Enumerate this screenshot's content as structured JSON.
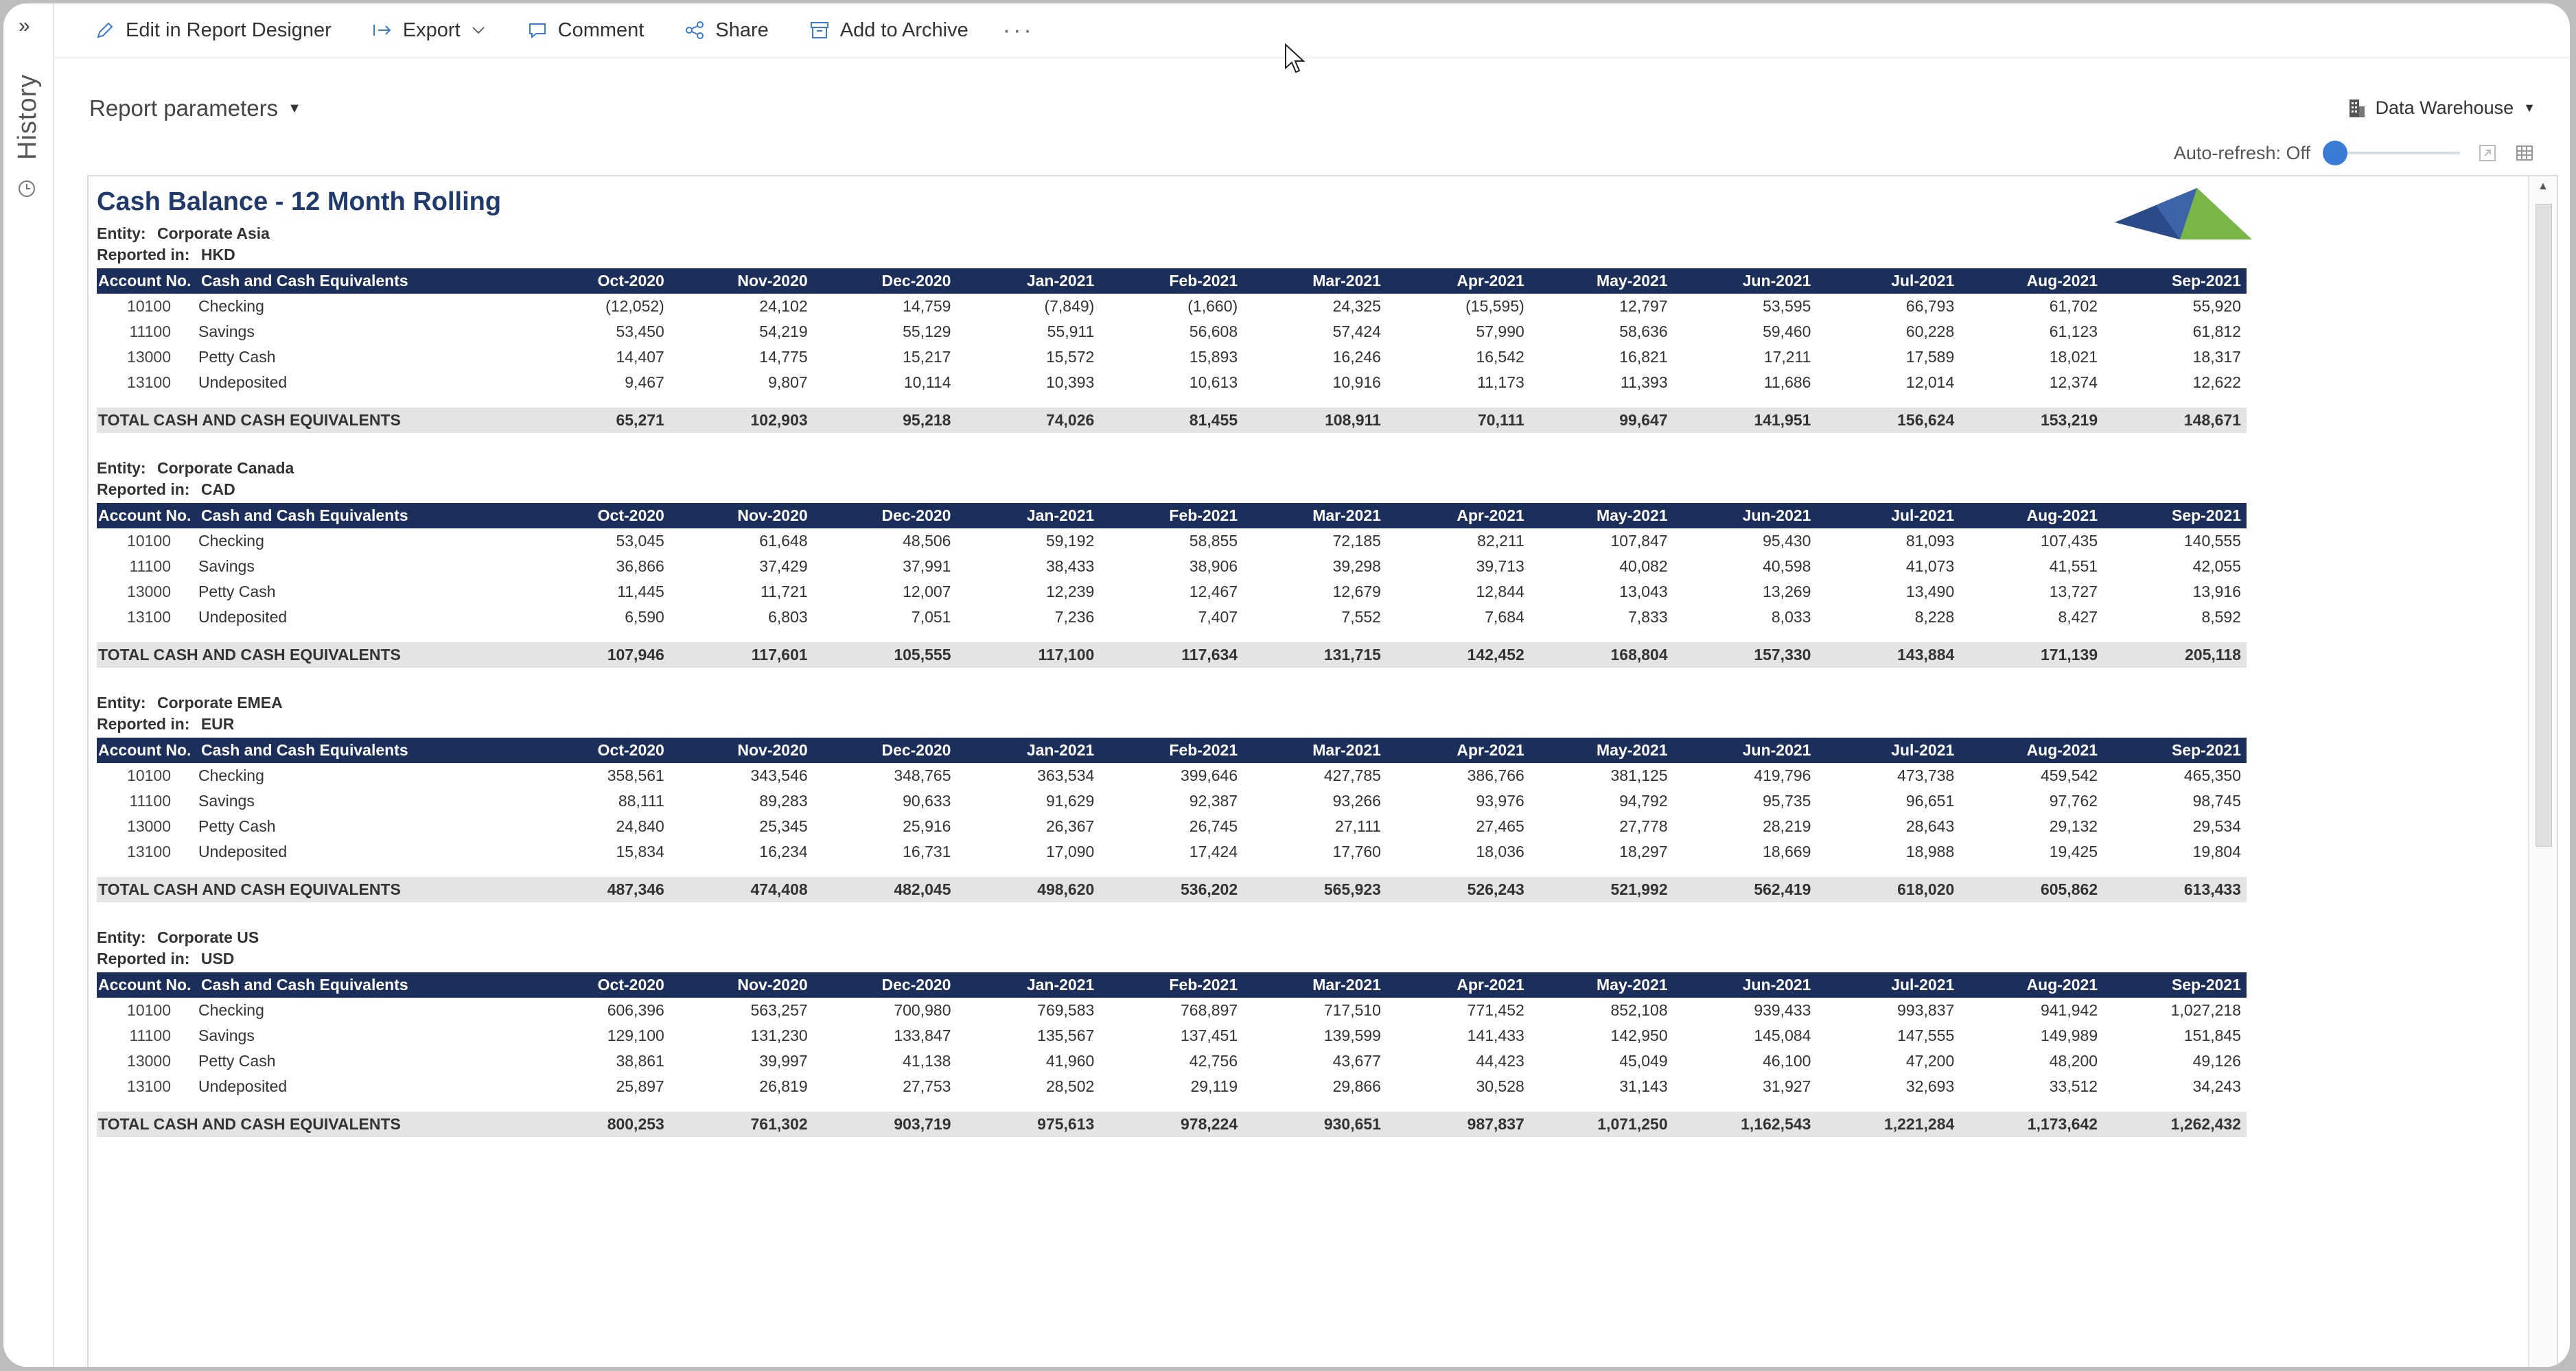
{
  "rail": {
    "label": "History"
  },
  "toolbar": {
    "edit": "Edit in Report Designer",
    "export": "Export",
    "comment": "Comment",
    "share": "Share",
    "archive": "Add to Archive",
    "more": "···"
  },
  "params": {
    "label": "Report parameters"
  },
  "datasource": {
    "label": "Data Warehouse"
  },
  "autorefresh": {
    "label": "Auto-refresh: Off",
    "level": 0
  },
  "report": {
    "title": "Cash Balance - 12 Month Rolling",
    "entity_label": "Entity:",
    "reported_label": "Reported in:",
    "total_label": "TOTAL CASH AND CASH EQUIVALENTS",
    "header_acc": "Account No.",
    "header_desc": "Cash and Cash Equivalents",
    "months": [
      "Oct-2020",
      "Nov-2020",
      "Dec-2020",
      "Jan-2021",
      "Feb-2021",
      "Mar-2021",
      "Apr-2021",
      "May-2021",
      "Jun-2021",
      "Jul-2021",
      "Aug-2021",
      "Sep-2021"
    ],
    "entities": [
      {
        "name": "Corporate Asia",
        "currency": "HKD",
        "rows": [
          {
            "acc": "10100",
            "desc": "Checking",
            "vals": [
              "(12,052)",
              "24,102",
              "14,759",
              "(7,849)",
              "(1,660)",
              "24,325",
              "(15,595)",
              "12,797",
              "53,595",
              "66,793",
              "61,702",
              "55,920"
            ]
          },
          {
            "acc": "11100",
            "desc": "Savings",
            "vals": [
              "53,450",
              "54,219",
              "55,129",
              "55,911",
              "56,608",
              "57,424",
              "57,990",
              "58,636",
              "59,460",
              "60,228",
              "61,123",
              "61,812"
            ]
          },
          {
            "acc": "13000",
            "desc": "Petty Cash",
            "vals": [
              "14,407",
              "14,775",
              "15,217",
              "15,572",
              "15,893",
              "16,246",
              "16,542",
              "16,821",
              "17,211",
              "17,589",
              "18,021",
              "18,317"
            ]
          },
          {
            "acc": "13100",
            "desc": "Undeposited",
            "vals": [
              "9,467",
              "9,807",
              "10,114",
              "10,393",
              "10,613",
              "10,916",
              "11,173",
              "11,393",
              "11,686",
              "12,014",
              "12,374",
              "12,622"
            ]
          }
        ],
        "total": [
          "65,271",
          "102,903",
          "95,218",
          "74,026",
          "81,455",
          "108,911",
          "70,111",
          "99,647",
          "141,951",
          "156,624",
          "153,219",
          "148,671"
        ]
      },
      {
        "name": "Corporate Canada",
        "currency": "CAD",
        "rows": [
          {
            "acc": "10100",
            "desc": "Checking",
            "vals": [
              "53,045",
              "61,648",
              "48,506",
              "59,192",
              "58,855",
              "72,185",
              "82,211",
              "107,847",
              "95,430",
              "81,093",
              "107,435",
              "140,555"
            ]
          },
          {
            "acc": "11100",
            "desc": "Savings",
            "vals": [
              "36,866",
              "37,429",
              "37,991",
              "38,433",
              "38,906",
              "39,298",
              "39,713",
              "40,082",
              "40,598",
              "41,073",
              "41,551",
              "42,055"
            ]
          },
          {
            "acc": "13000",
            "desc": "Petty Cash",
            "vals": [
              "11,445",
              "11,721",
              "12,007",
              "12,239",
              "12,467",
              "12,679",
              "12,844",
              "13,043",
              "13,269",
              "13,490",
              "13,727",
              "13,916"
            ]
          },
          {
            "acc": "13100",
            "desc": "Undeposited",
            "vals": [
              "6,590",
              "6,803",
              "7,051",
              "7,236",
              "7,407",
              "7,552",
              "7,684",
              "7,833",
              "8,033",
              "8,228",
              "8,427",
              "8,592"
            ]
          }
        ],
        "total": [
          "107,946",
          "117,601",
          "105,555",
          "117,100",
          "117,634",
          "131,715",
          "142,452",
          "168,804",
          "157,330",
          "143,884",
          "171,139",
          "205,118"
        ]
      },
      {
        "name": "Corporate EMEA",
        "currency": "EUR",
        "rows": [
          {
            "acc": "10100",
            "desc": "Checking",
            "vals": [
              "358,561",
              "343,546",
              "348,765",
              "363,534",
              "399,646",
              "427,785",
              "386,766",
              "381,125",
              "419,796",
              "473,738",
              "459,542",
              "465,350"
            ]
          },
          {
            "acc": "11100",
            "desc": "Savings",
            "vals": [
              "88,111",
              "89,283",
              "90,633",
              "91,629",
              "92,387",
              "93,266",
              "93,976",
              "94,792",
              "95,735",
              "96,651",
              "97,762",
              "98,745"
            ]
          },
          {
            "acc": "13000",
            "desc": "Petty Cash",
            "vals": [
              "24,840",
              "25,345",
              "25,916",
              "26,367",
              "26,745",
              "27,111",
              "27,465",
              "27,778",
              "28,219",
              "28,643",
              "29,132",
              "29,534"
            ]
          },
          {
            "acc": "13100",
            "desc": "Undeposited",
            "vals": [
              "15,834",
              "16,234",
              "16,731",
              "17,090",
              "17,424",
              "17,760",
              "18,036",
              "18,297",
              "18,669",
              "18,988",
              "19,425",
              "19,804"
            ]
          }
        ],
        "total": [
          "487,346",
          "474,408",
          "482,045",
          "498,620",
          "536,202",
          "565,923",
          "526,243",
          "521,992",
          "562,419",
          "618,020",
          "605,862",
          "613,433"
        ]
      },
      {
        "name": "Corporate US",
        "currency": "USD",
        "rows": [
          {
            "acc": "10100",
            "desc": "Checking",
            "vals": [
              "606,396",
              "563,257",
              "700,980",
              "769,583",
              "768,897",
              "717,510",
              "771,452",
              "852,108",
              "939,433",
              "993,837",
              "941,942",
              "1,027,218"
            ]
          },
          {
            "acc": "11100",
            "desc": "Savings",
            "vals": [
              "129,100",
              "131,230",
              "133,847",
              "135,567",
              "137,451",
              "139,599",
              "141,433",
              "142,950",
              "145,084",
              "147,555",
              "149,989",
              "151,845"
            ]
          },
          {
            "acc": "13000",
            "desc": "Petty Cash",
            "vals": [
              "38,861",
              "39,997",
              "41,138",
              "41,960",
              "42,756",
              "43,677",
              "44,423",
              "45,049",
              "46,100",
              "47,200",
              "48,200",
              "49,126"
            ]
          },
          {
            "acc": "13100",
            "desc": "Undeposited",
            "vals": [
              "25,897",
              "26,819",
              "27,753",
              "28,502",
              "29,119",
              "29,866",
              "30,528",
              "31,143",
              "31,927",
              "32,693",
              "33,512",
              "34,243"
            ]
          }
        ],
        "total": [
          "800,253",
          "761,302",
          "903,719",
          "975,613",
          "978,224",
          "930,651",
          "987,837",
          "1,071,250",
          "1,162,543",
          "1,221,284",
          "1,173,642",
          "1,262,432"
        ]
      }
    ]
  },
  "colors": {
    "header_bg": "#1b2f5a",
    "title": "#1f3a6b",
    "total_bg": "#e4e4e4",
    "accent": "#3a7bd5",
    "logo_blue": "#2a4a8a",
    "logo_green": "#7ab547"
  }
}
